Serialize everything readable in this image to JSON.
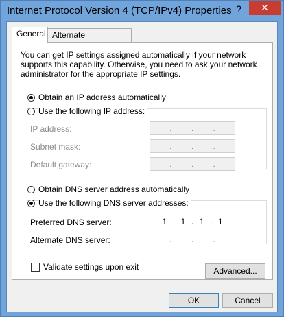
{
  "window": {
    "title": "Internet Protocol Version 4 (TCP/IPv4) Properties",
    "help_glyph": "?",
    "close_glyph": "✕"
  },
  "tabs": [
    {
      "label": "General",
      "active": true
    },
    {
      "label": "Alternate Configuration",
      "active": false
    }
  ],
  "intro_text": "You can get IP settings assigned automatically if your network supports this capability. Otherwise, you need to ask your network administrator for the appropriate IP settings.",
  "ip_section": {
    "auto_label": "Obtain an IP address automatically",
    "manual_label": "Use the following IP address:",
    "selected": "auto",
    "fields": [
      {
        "label": "IP address:",
        "octets": [
          "",
          "",
          "",
          ""
        ]
      },
      {
        "label": "Subnet mask:",
        "octets": [
          "",
          "",
          "",
          ""
        ]
      },
      {
        "label": "Default gateway:",
        "octets": [
          "",
          "",
          "",
          ""
        ]
      }
    ]
  },
  "dns_section": {
    "auto_label": "Obtain DNS server address automatically",
    "manual_label": "Use the following DNS server addresses:",
    "selected": "manual",
    "fields": [
      {
        "label": "Preferred DNS server:",
        "octets": [
          "1",
          "1",
          "1",
          "1"
        ]
      },
      {
        "label": "Alternate DNS server:",
        "octets": [
          "",
          "",
          "",
          ""
        ]
      }
    ]
  },
  "validate_label": "Validate settings upon exit",
  "validate_checked": false,
  "buttons": {
    "advanced": "Advanced...",
    "ok": "OK",
    "cancel": "Cancel"
  },
  "dot": "."
}
